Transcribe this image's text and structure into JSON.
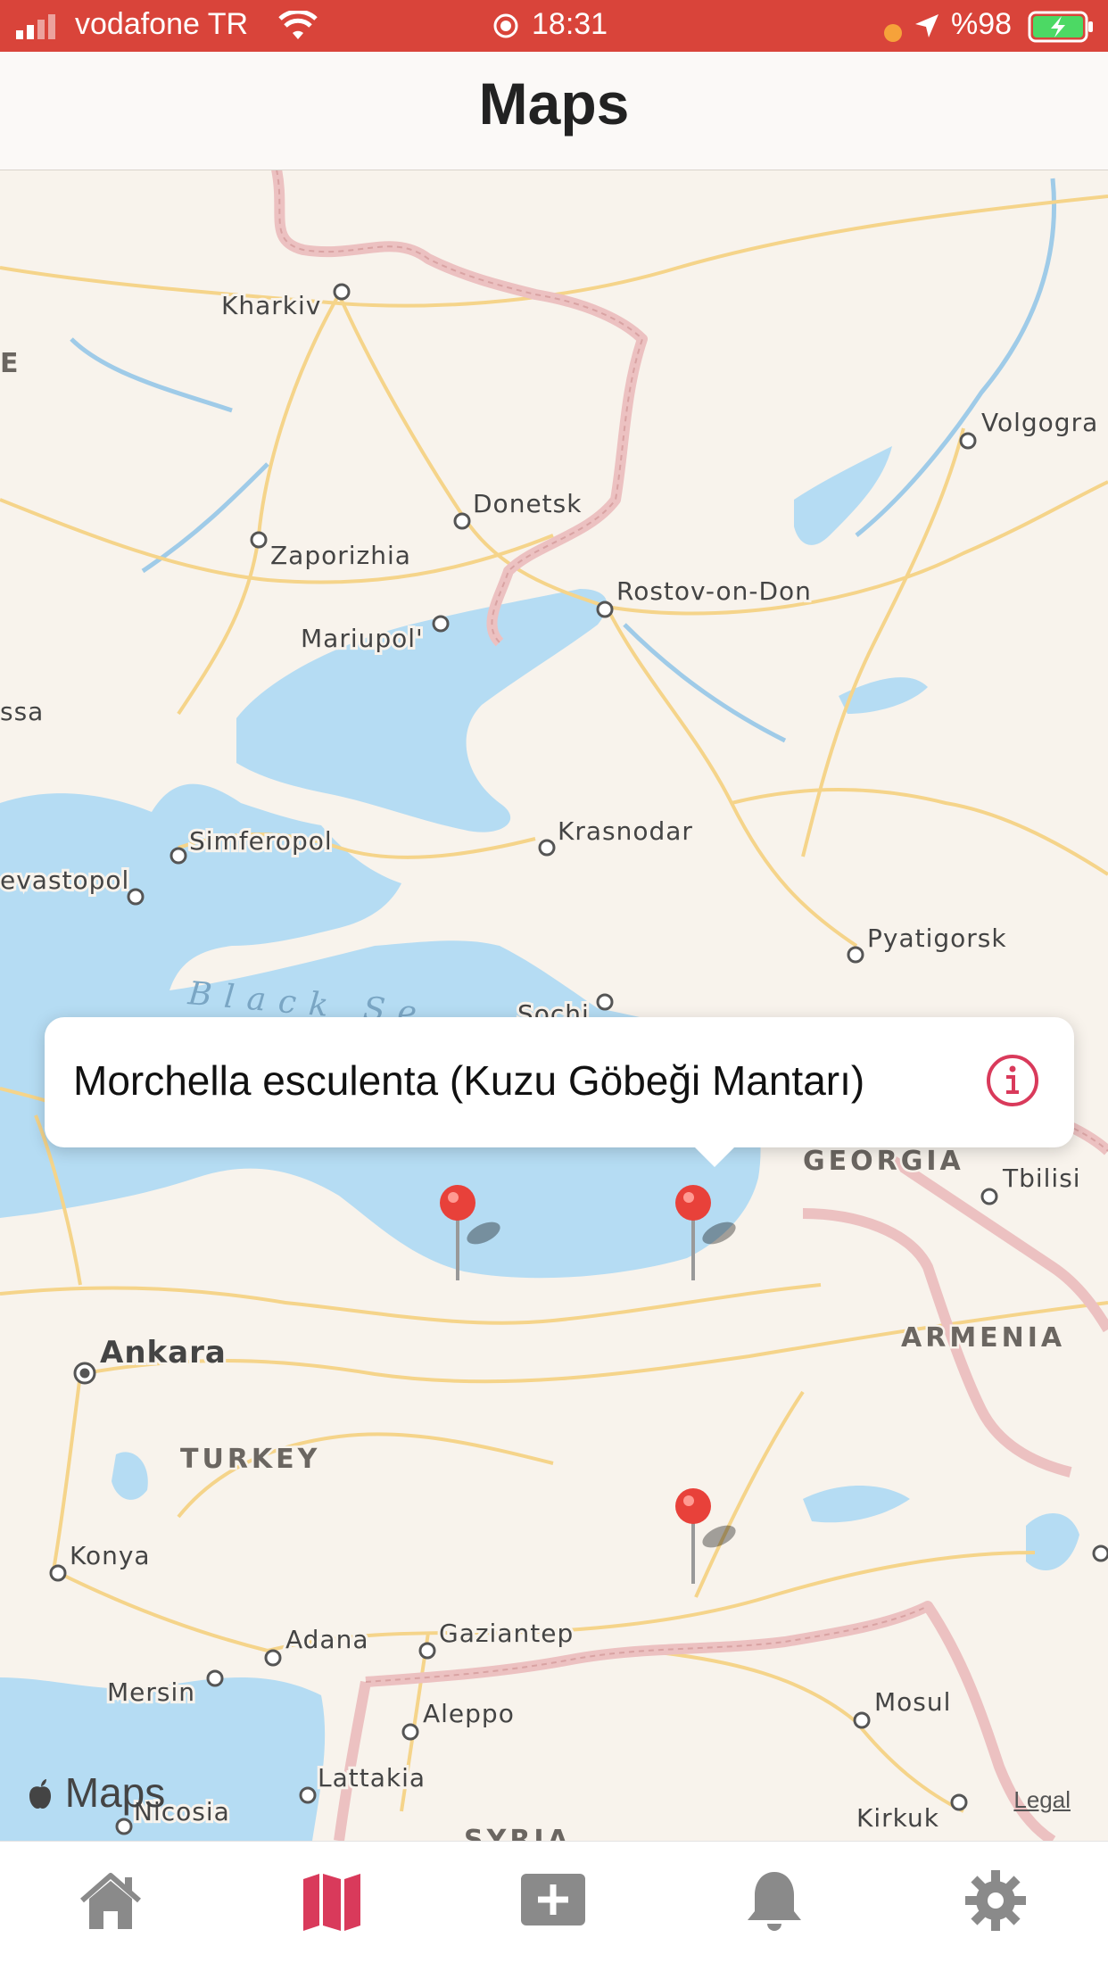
{
  "status_bar": {
    "carrier": "vodafone TR",
    "time": "18:31",
    "battery": "%98"
  },
  "header": {
    "title": "Maps"
  },
  "map": {
    "cities": [
      "Kharkiv",
      "Volgogra",
      "Donetsk",
      "Zaporizhia",
      "Rostov-on-Don",
      "Mariupol'",
      "ssa",
      "Simferopol",
      "Krasnodar",
      "evastopol",
      "Pyatigorsk",
      "Sochi",
      "Tbilisi",
      "Ankara",
      "Konya",
      "Adana",
      "Gaziantep",
      "Mersin",
      "Aleppo",
      "Mosul",
      "Lattakia",
      "Nicosia",
      "Kirkuk"
    ],
    "countries": [
      "E",
      "GEORGIA",
      "ARMENIA",
      "TURKEY",
      "SYRIA"
    ],
    "sea_label": "Black Se",
    "attribution": "Maps",
    "legal": "Legal",
    "pins": 3
  },
  "callout": {
    "title": "Morchella esculenta (Kuzu Göbeği Mantarı)",
    "info_icon": "info-circle-icon"
  },
  "tabbar": {
    "items": [
      "home-icon",
      "map-icon",
      "add-icon",
      "bell-icon",
      "gear-icon"
    ],
    "active": "map-icon",
    "active_color": "#d93a5b",
    "inactive_color": "#8a8a8a"
  },
  "colors": {
    "status_bar": "#d9443a",
    "water": "#b5dcf3",
    "land": "#f8f3ec",
    "road": "#f5d48a",
    "border": "#ecc1c1",
    "pin": "#e8413a"
  }
}
